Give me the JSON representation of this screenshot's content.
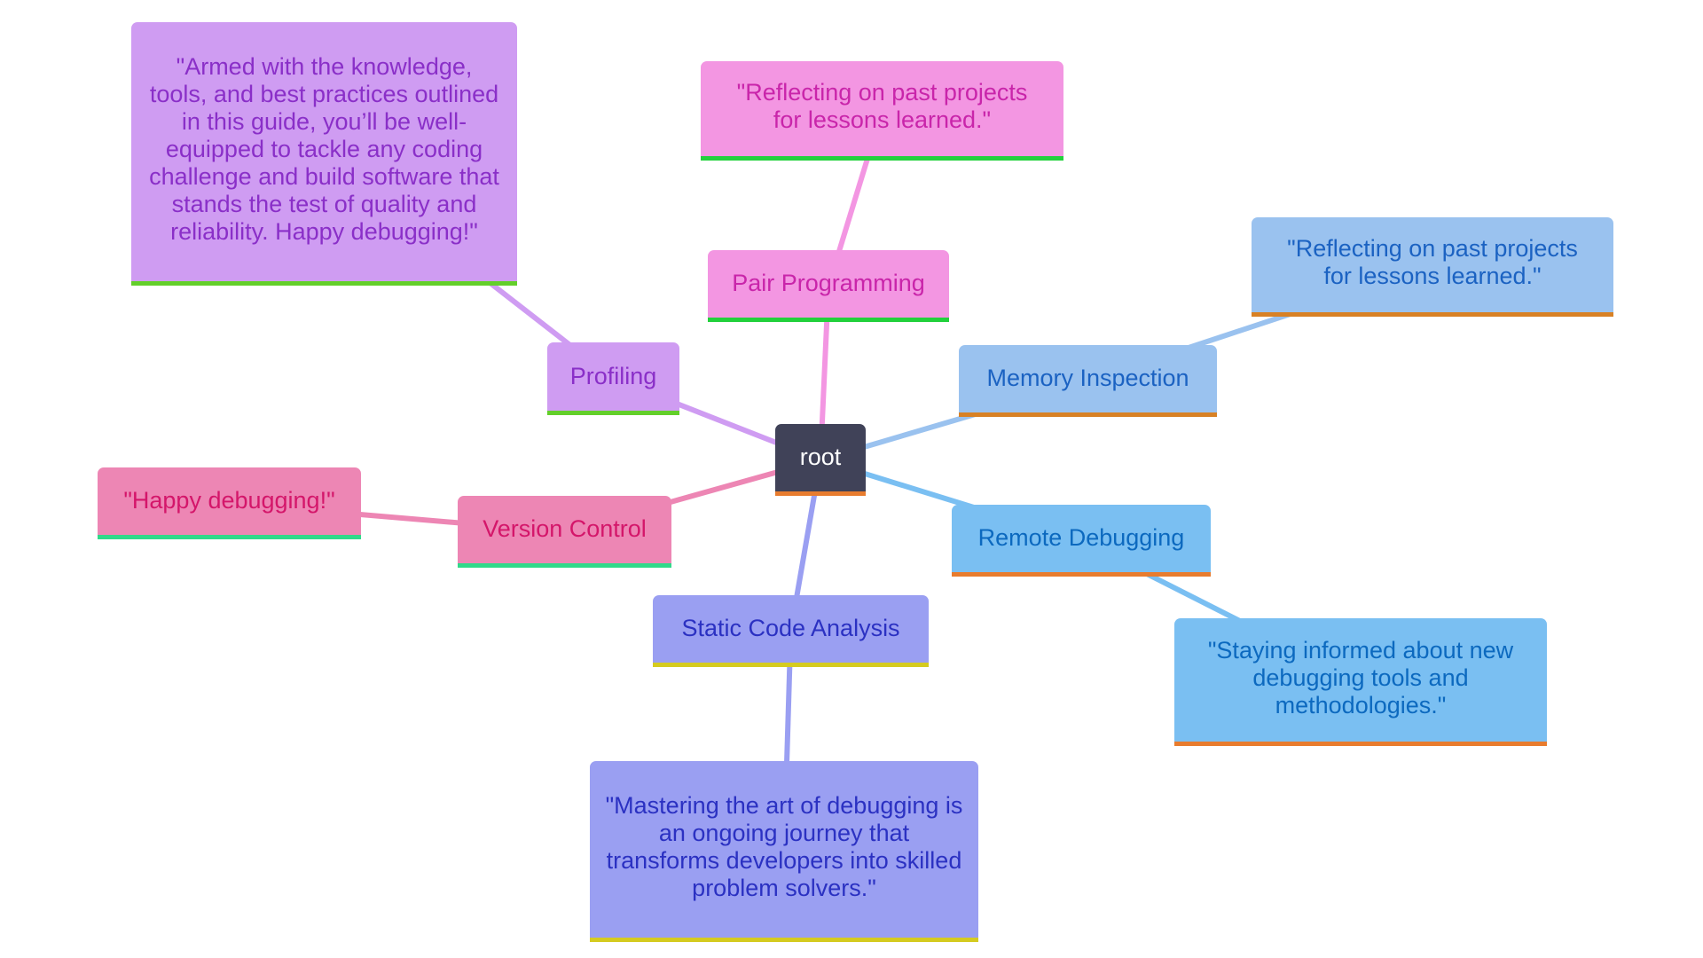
{
  "diagram": {
    "type": "mindmap",
    "root": {
      "id": "root",
      "label": "root",
      "fill": "#404258",
      "text_color": "#ffffff",
      "bar_color": "#e87c2e",
      "edge_color": "#404258"
    },
    "branches": [
      {
        "id": "profiling",
        "label": "Profiling",
        "fill": "#cf9cf2",
        "text_color": "#8a2fc8",
        "bar_color": "#63cf2a",
        "edge_color": "#cf9cf2",
        "child": {
          "id": "profiling-quote",
          "label": "\"Armed with the knowledge, tools, and best practices outlined in this guide, you’ll be well-equipped to tackle any coding challenge and build software that stands the test of quality and reliability. Happy debugging!\""
        }
      },
      {
        "id": "pair-programming",
        "label": "Pair Programming",
        "fill": "#f396e2",
        "text_color": "#c925aa",
        "bar_color": "#22d13c",
        "edge_color": "#f396e2",
        "child": {
          "id": "pair-quote",
          "label": "\"Reflecting on past projects for lessons learned.\""
        }
      },
      {
        "id": "memory-inspection",
        "label": "Memory Inspection",
        "fill": "#9ac2ef",
        "text_color": "#1b62c2",
        "bar_color": "#d88125",
        "edge_color": "#9ac2ef",
        "child": {
          "id": "memory-quote",
          "label": "\"Reflecting on past projects for lessons learned.\""
        }
      },
      {
        "id": "remote-debugging",
        "label": "Remote Debugging",
        "fill": "#7abff2",
        "text_color": "#0c69bf",
        "bar_color": "#e87c2e",
        "edge_color": "#7abff2",
        "child": {
          "id": "remote-quote",
          "label": "\"Staying informed about new debugging tools and methodologies.\""
        }
      },
      {
        "id": "static-code-analysis",
        "label": "Static Code Analysis",
        "fill": "#9a9ff2",
        "text_color": "#2b31c2",
        "bar_color": "#d5cb20",
        "edge_color": "#9a9ff2",
        "child": {
          "id": "static-quote",
          "label": "\"Mastering the art of debugging is an ongoing journey that transforms developers into skilled problem solvers.\""
        }
      },
      {
        "id": "version-control",
        "label": "Version Control",
        "fill": "#ed86b4",
        "text_color": "#d4166a",
        "bar_color": "#31d98a",
        "edge_color": "#ed86b4",
        "child": {
          "id": "version-quote",
          "label": "\"Happy debugging!\""
        }
      }
    ]
  }
}
